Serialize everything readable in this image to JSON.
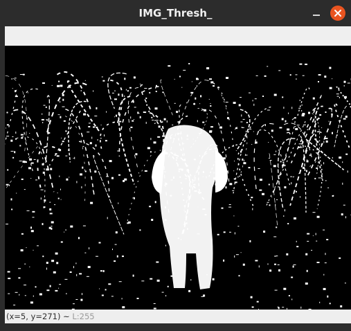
{
  "window": {
    "title": "IMG_Thresh_",
    "accent_close": "#e95420",
    "titlebar_bg": "#2c2c2c"
  },
  "icons": {
    "minimize": "minimize-icon",
    "close": "close-icon"
  },
  "image": {
    "kind": "binary threshold image",
    "foreground": "#ffffff",
    "background": "#000000"
  },
  "status": {
    "coords": "(x=5, y=271) ~ ",
    "level": "L:255"
  }
}
